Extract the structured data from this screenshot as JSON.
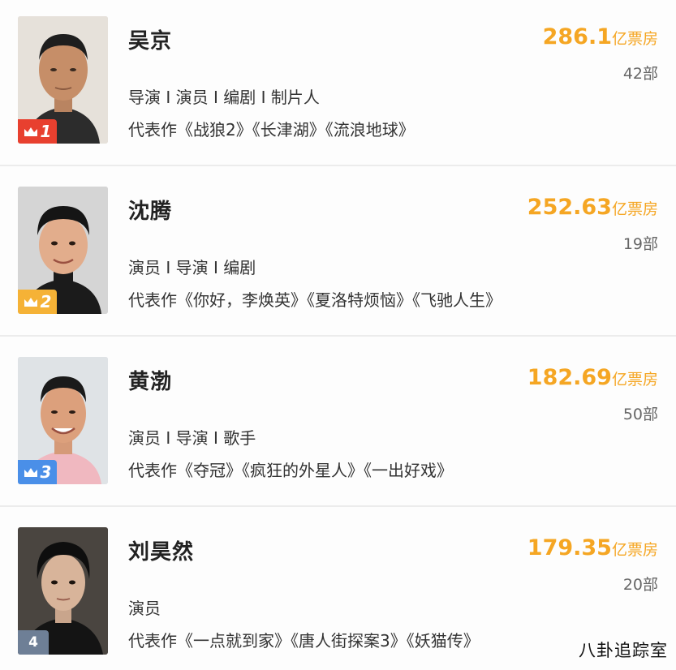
{
  "colors": {
    "accent": "#f5a623",
    "rank1": "#e8402f",
    "rank2": "#f5b236",
    "rank3": "#4a8fe8",
    "rank4": "#6e7f96"
  },
  "entries": [
    {
      "rank": "1",
      "name": "吴京",
      "box_office_value": "286.1",
      "box_office_unit": "亿票房",
      "film_count": "42部",
      "roles": "导演 I 演员 I 编剧 I 制片人",
      "works": "代表作《战狼2》《长津湖》《流浪地球》",
      "badge_icon": "crown-icon"
    },
    {
      "rank": "2",
      "name": "沈腾",
      "box_office_value": "252.63",
      "box_office_unit": "亿票房",
      "film_count": "19部",
      "roles": "演员 I 导演 I 编剧",
      "works": "代表作《你好，李焕英》《夏洛特烦恼》《飞驰人生》",
      "badge_icon": "crown-icon"
    },
    {
      "rank": "3",
      "name": "黄渤",
      "box_office_value": "182.69",
      "box_office_unit": "亿票房",
      "film_count": "50部",
      "roles": "演员 I 导演 I 歌手",
      "works": "代表作《夺冠》《疯狂的外星人》《一出好戏》",
      "badge_icon": "crown-icon"
    },
    {
      "rank": "4",
      "name": "刘昊然",
      "box_office_value": "179.35",
      "box_office_unit": "亿票房",
      "film_count": "20部",
      "roles": "演员",
      "works": "代表作《一点就到家》《唐人街探案3》《妖猫传》",
      "badge_icon": ""
    }
  ],
  "watermark": "八卦追踪室"
}
